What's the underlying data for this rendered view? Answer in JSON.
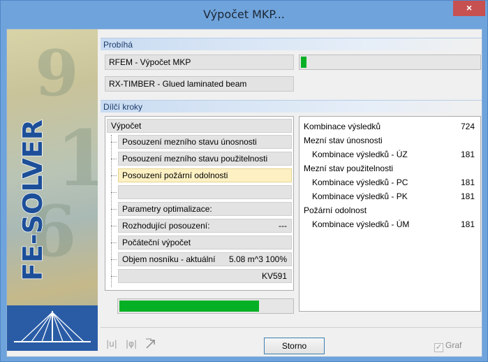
{
  "window": {
    "title": "Výpočet MKP...",
    "close_label": "×"
  },
  "banner": {
    "text": "FE-SOLVER"
  },
  "running": {
    "heading": "Probíhá",
    "task1": "RFEM - Výpočet MKP",
    "task2": "RX-TIMBER - Glued laminated beam",
    "task1_progress_percent": 3
  },
  "steps": {
    "heading": "Dílčí kroky",
    "root": "Výpočet",
    "items": [
      "Posouzení mezního stavu únosnosti",
      "Posouzení mezního stavu použitelnosti",
      "Posouzení požární odolnosti",
      "",
      "Parametry optimalizace:",
      "Rozhodující posouzení:",
      "Počáteční výpočet",
      "Objem nosníku - aktuální",
      ""
    ],
    "decisive_value": "---",
    "volume_value": "5.08 m^3  100%",
    "profile": "KV591",
    "active_index": 2,
    "progress_percent": 81
  },
  "results": {
    "rows": [
      {
        "label": "Kombinace výsledků",
        "value": "724",
        "indent": false
      },
      {
        "label": "Mezní stav únosnosti",
        "value": "",
        "indent": false
      },
      {
        "label": "Kombinace výsledků - ÚZ",
        "value": "181",
        "indent": true
      },
      {
        "label": "Mezní stav použitelnosti",
        "value": "",
        "indent": false
      },
      {
        "label": "Kombinace výsledků - PC",
        "value": "181",
        "indent": true
      },
      {
        "label": "Kombinace výsledků - PK",
        "value": "181",
        "indent": true
      },
      {
        "label": "Požární odolnost",
        "value": "",
        "indent": false
      },
      {
        "label": "Kombinace výsledků - ÚM",
        "value": "181",
        "indent": true
      }
    ]
  },
  "footer": {
    "icon1": "|u|",
    "icon2": "|φ|",
    "cancel_label": "Storno",
    "graph_label": "Graf",
    "graph_checked": true
  },
  "colors": {
    "accent": "#6fa3dc",
    "progress": "#06b025",
    "active_step": "#fdf1c4"
  }
}
